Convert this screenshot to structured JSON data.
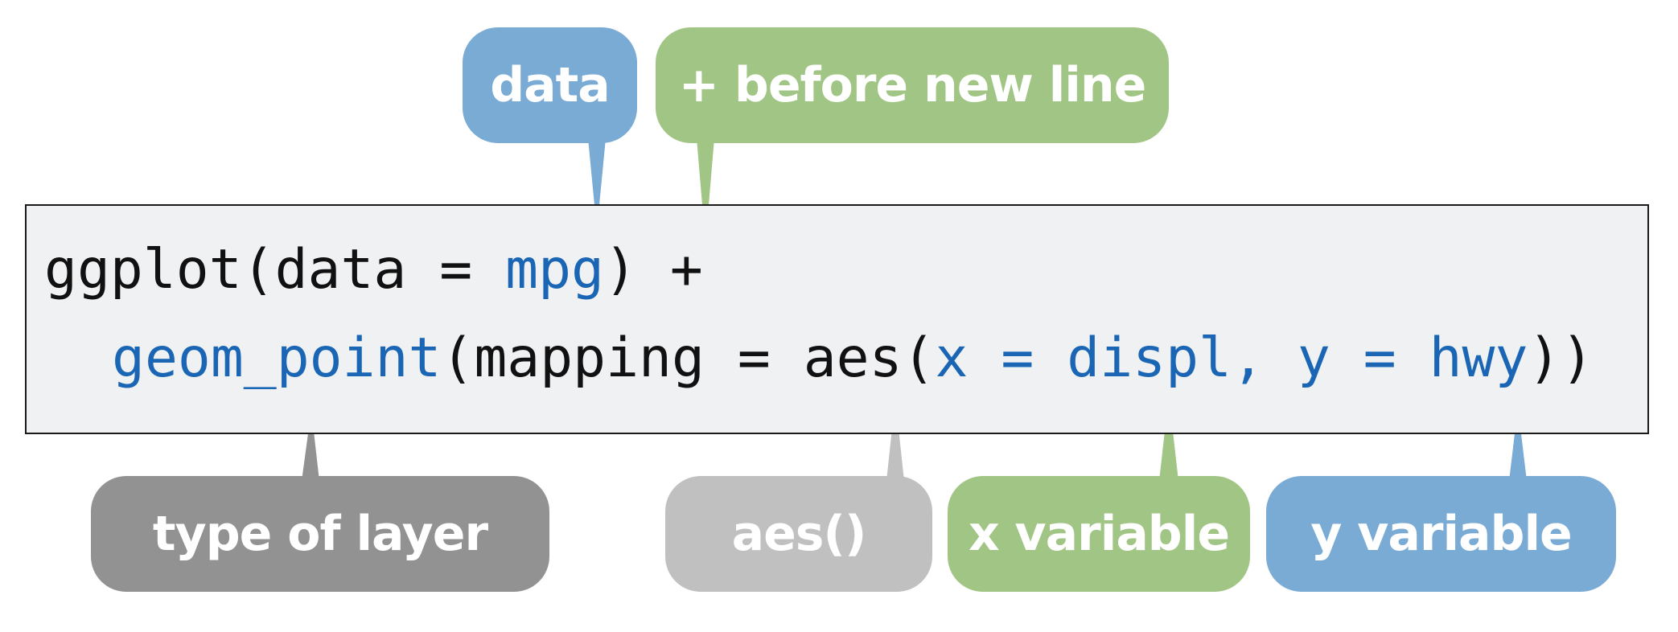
{
  "colors": {
    "blue": "#7aabd5",
    "green": "#a1c584",
    "dark_gray": "#929292",
    "light_gray": "#c0c0c0",
    "code_highlight": "#1a66b5",
    "code_background": "#f0f1f3"
  },
  "callouts": {
    "data": "data",
    "plus_new_line": "+ before new line",
    "type_of_layer": "type of layer",
    "aes": "aes()",
    "x_variable": "x variable",
    "y_variable": "y variable"
  },
  "code": {
    "line1": {
      "fn": "ggplot(",
      "arg": "data = ",
      "dataset": "mpg",
      "close": ") +"
    },
    "line2": {
      "geom": "geom_point",
      "open": "(mapping = aes(",
      "x_expr": "x = displ, y = hwy",
      "close": "))"
    }
  }
}
